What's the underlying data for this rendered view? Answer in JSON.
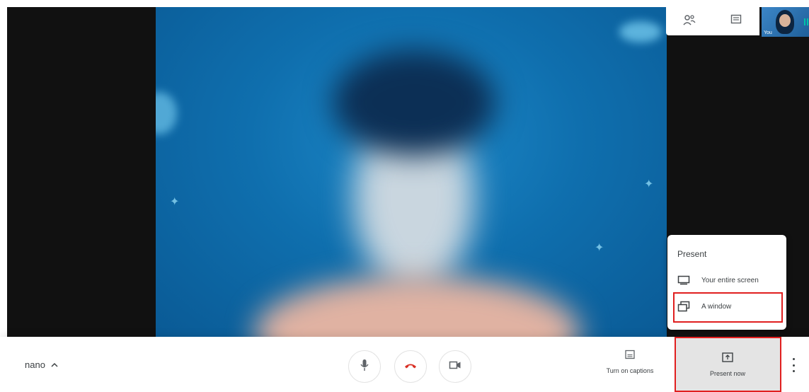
{
  "colors": {
    "highlight": "#e01f1f",
    "end_call": "#d93025",
    "accent_teal": "#00c2a8"
  },
  "top_tiles": {
    "people_icon": "people-icon",
    "chat_icon": "chat-icon",
    "self_label": "You"
  },
  "present_menu": {
    "title": "Present",
    "items": [
      {
        "label": "Your entire screen",
        "icon": "monitor-icon"
      },
      {
        "label": "A window",
        "icon": "window-icon"
      }
    ]
  },
  "bottom_bar": {
    "meeting_name": "nano",
    "captions_label": "Turn on captions",
    "present_now_label": "Present now"
  }
}
